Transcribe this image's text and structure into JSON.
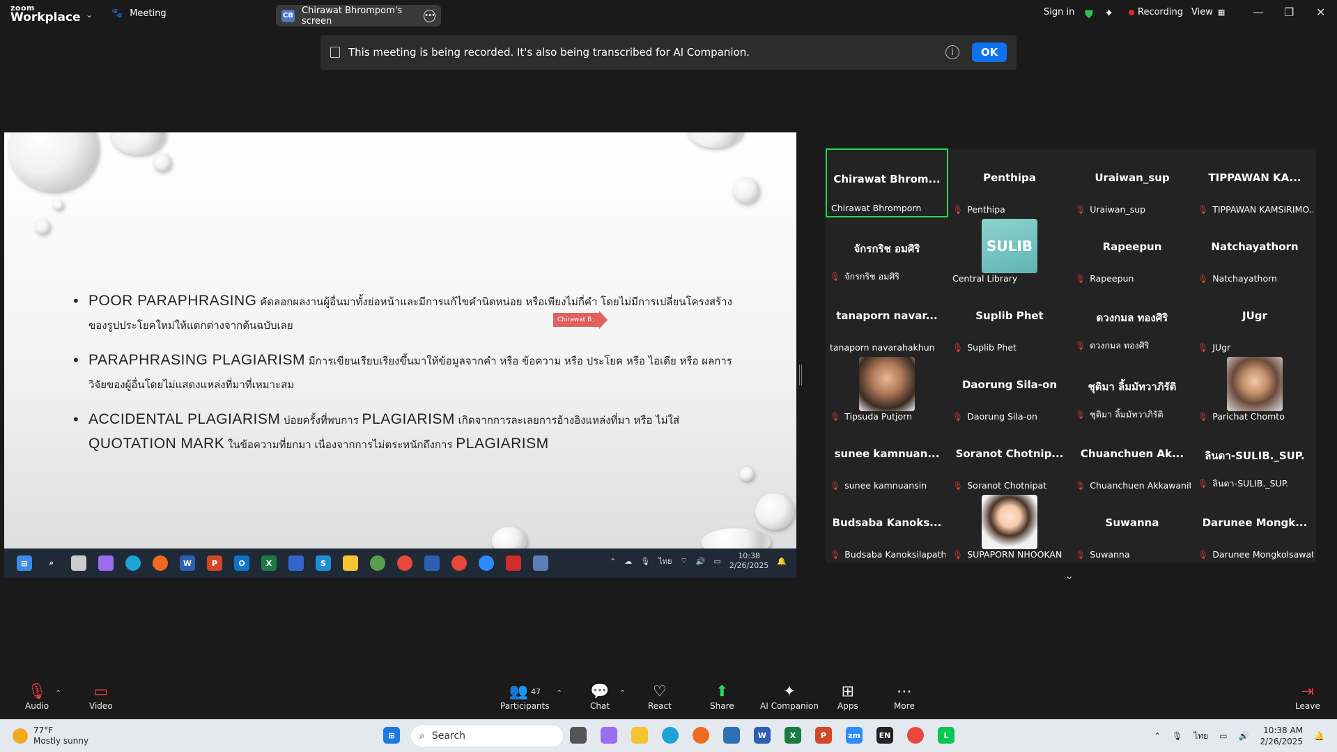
{
  "app": {
    "brand_line1": "zoom",
    "brand_line2": "Workplace",
    "meeting_label": "Meeting",
    "screen_tab_initials": "CB",
    "screen_tab_label": "Chirawat Bhrompom's screen",
    "sign_in": "Sign in",
    "recording_label": "Recording",
    "view_label": "View"
  },
  "notice": {
    "text": "This meeting is being recorded. It's also being transcribed for AI Companion.",
    "ok_label": "OK"
  },
  "slide": {
    "bullets": [
      {
        "en": "POOR PARAPHRASING",
        "th": " คัดลอกผลงานผู้อื่นมาทั้งย่อหน้าและมีการแก้ไขคำนิดหน่อย หรือเพียงไม่กี่คำ โดยไม่มีการเปลี่ยนโครงสร้างของรูปประโยคใหม่ให้แตกต่างจากต้นฉบับเลย"
      },
      {
        "en": "PARAPHRASING PLAGIARISM",
        "th": " มีการเขียนเรียบเรียงขึ้นมาให้ข้อมูลจากคำ หรือ ข้อความ หรือ ประโยค หรือ ไอเดีย หรือ ผลการวิจัยของผู้อื่นโดยไม่แสดงแหล่งที่มาที่เหมาะสม"
      },
      {
        "en1": "ACCIDENTAL PLAGIARISM",
        "th1": " บ่อยครั้งที่พบการ ",
        "en2": "PLAGIARISM",
        "th2": " เกิดจากการละเลยการอ้างอิงแหล่งที่มา หรือ ไม่ใส่ ",
        "en3": "QUOTATION MARK",
        "th3": " ในข้อความที่ยกมา เนื่องจากการไม่ตระหนักถึงการ ",
        "en4": "PLAGIARISM"
      }
    ],
    "pointer_label": "Chirawat B"
  },
  "presenter_taskbar": {
    "time": "10:38",
    "date": "2/26/2025",
    "lang": "ไทย"
  },
  "participants": [
    {
      "big": "Chirawat Bhrom...",
      "small": "Chirawat Bhromporn",
      "muted": false,
      "active": true
    },
    {
      "big": "Penthipa",
      "small": "Penthipa",
      "muted": true
    },
    {
      "big": "Uraiwan_sup",
      "small": "Uraiwan_sup",
      "muted": true
    },
    {
      "big": "TIPPAWAN KA...",
      "small": "TIPPAWAN KAMSIRIMO...",
      "muted": true
    },
    {
      "big": "จักรกริช อมศิริ",
      "small": "จักรกริช อมศิริ",
      "muted": true
    },
    {
      "big": "",
      "small": "Central Library",
      "muted": false,
      "image": "sulib-logo",
      "image_text": "SULIB"
    },
    {
      "big": "Rapeepun",
      "small": "Rapeepun",
      "muted": true
    },
    {
      "big": "Natchayathorn",
      "small": "Natchayathorn",
      "muted": true
    },
    {
      "big": "tanaporn navar...",
      "small": "tanaporn navarahakhun",
      "muted": false
    },
    {
      "big": "Suplib Phet",
      "small": "Suplib Phet",
      "muted": true
    },
    {
      "big": "ดวงกมล ทองศิริ",
      "small": "ดวงกมล ทองศิริ",
      "muted": true
    },
    {
      "big": "JUgr",
      "small": "JUgr",
      "muted": true
    },
    {
      "big": "",
      "small": "Tipsuda Putjorn",
      "muted": true,
      "image": "photo-woman-1"
    },
    {
      "big": "Daorung Sila-on",
      "small": "Daorung Sila-on",
      "muted": true
    },
    {
      "big": "ชุติมา ลิ้มมัทวาภิรัติ",
      "small": "ชุติมา ลิ้มมัทวาภิรัติ",
      "muted": true
    },
    {
      "big": "",
      "small": "Parichat Chomto",
      "muted": true,
      "image": "photo-woman-2"
    },
    {
      "big": "sunee kamnuan...",
      "small": "sunee kamnuansin",
      "muted": true
    },
    {
      "big": "Soranot Chotnip...",
      "small": "Soranot Chotnipat",
      "muted": true
    },
    {
      "big": "Chuanchuen Ak...",
      "small": "Chuanchuen Akkawanitcha",
      "muted": true
    },
    {
      "big": "ลินดา-SULIB._SUP.",
      "small": "ลินดา-SULIB._SUP.",
      "muted": true
    },
    {
      "big": "Budsaba Kanoks...",
      "small": "Budsaba Kanoksilapatha...",
      "muted": true
    },
    {
      "big": "",
      "small": "SUPAPORN NHOOKAN",
      "muted": true,
      "image": "cartoon-avatar"
    },
    {
      "big": "Suwanna",
      "small": "Suwanna",
      "muted": true
    },
    {
      "big": "Darunee Mongk...",
      "small": "Darunee Mongkolsawat",
      "muted": true
    }
  ],
  "controls": {
    "audio": "Audio",
    "video": "Video",
    "participants": "Participants",
    "participants_count": "47",
    "chat": "Chat",
    "react": "React",
    "share": "Share",
    "ai_companion": "AI Companion",
    "apps": "Apps",
    "more": "More",
    "leave": "Leave"
  },
  "windows": {
    "temp": "77°F",
    "weather": "Mostly sunny",
    "search_placeholder": "Search",
    "lang": "ไทย",
    "time": "10:38 AM",
    "date": "2/26/2025"
  },
  "colors": {
    "accent": "#0e72ed",
    "active_border": "#23d959",
    "muted_red": "#e03b3b",
    "recording_red": "#e02828"
  }
}
